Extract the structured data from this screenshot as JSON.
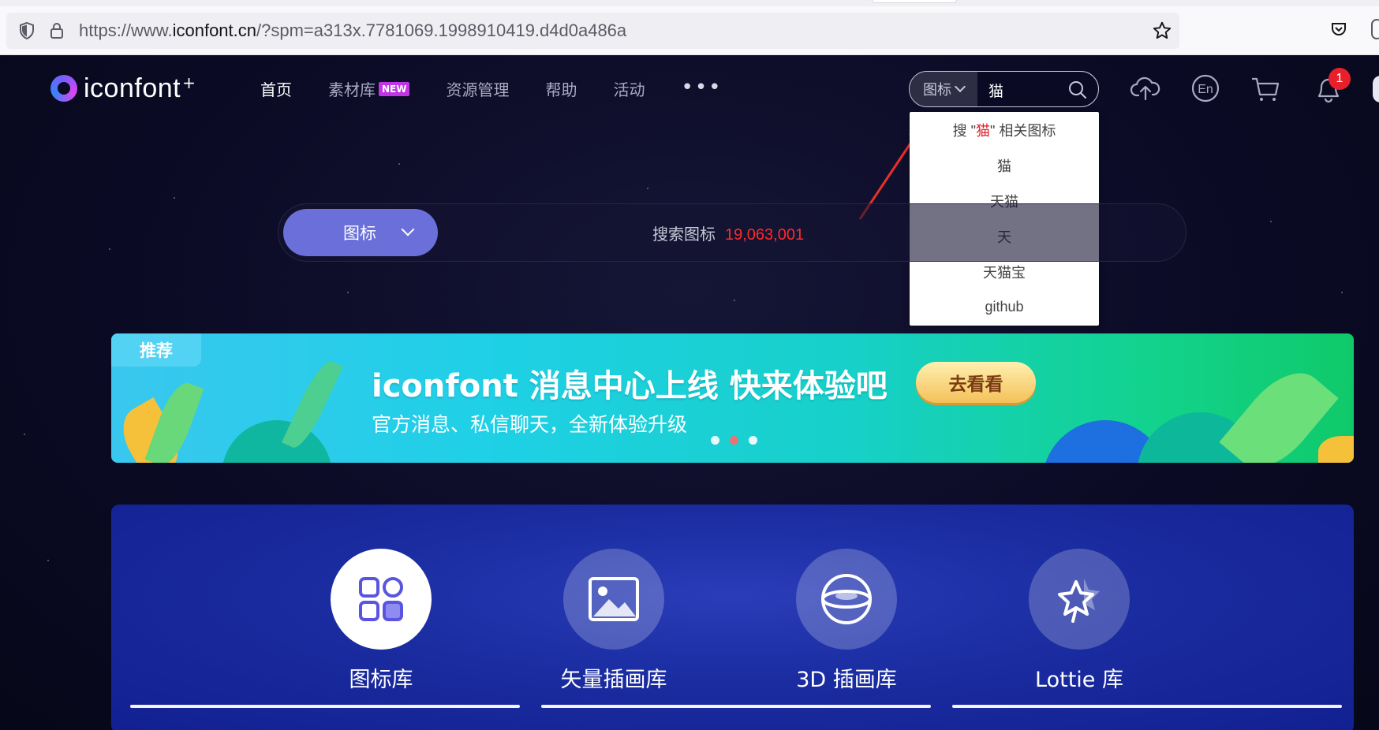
{
  "browser": {
    "url_prefix": "https://www.",
    "url_domain": "iconfont.cn",
    "url_suffix": "/?spm=a313x.7781069.1998910419.d4d0a486a"
  },
  "header": {
    "logo_text": "iconfont",
    "logo_plus": "+",
    "nav": [
      {
        "label": "首页",
        "active": true
      },
      {
        "label": "素材库",
        "badge": "NEW"
      },
      {
        "label": "资源管理"
      },
      {
        "label": "帮助"
      },
      {
        "label": "活动"
      }
    ],
    "more_label": "•••",
    "search": {
      "type_label": "图标",
      "value": "猫"
    },
    "icons": [
      "upload-cloud-icon",
      "language-en-icon",
      "cart-icon",
      "bell-icon"
    ],
    "notification_count": "1"
  },
  "dropdown": {
    "first_prefix": "搜 \"",
    "first_keyword": "猫",
    "first_suffix": "\" 相关图标",
    "suggestions": [
      "猫",
      "天猫",
      "天",
      "天猫宝",
      "github"
    ]
  },
  "hero_search": {
    "type_label": "图标",
    "placeholder": "搜索图标",
    "count": "19,063,001"
  },
  "banner": {
    "tag": "推荐",
    "title": "iconfont 消息中心上线  快来体验吧",
    "subtitle": "官方消息、私信聊天，全新体验升级",
    "cta": "去看看",
    "slides": 3,
    "active_slide": 2
  },
  "categories": [
    {
      "label": "图标库",
      "icon": "grid-icon"
    },
    {
      "label": "矢量插画库",
      "icon": "image-icon"
    },
    {
      "label": "3D 插画库",
      "icon": "sphere-icon"
    },
    {
      "label": "Lottie 库",
      "icon": "star-animation-icon"
    }
  ],
  "colors": {
    "page_bg": "#0a0a24",
    "accent": "#6b6fd9",
    "count_red": "#ff2a2a",
    "badge_red": "#e8202b",
    "new_badge": "#c234e6",
    "panel_blue": "#1a2ca0"
  }
}
